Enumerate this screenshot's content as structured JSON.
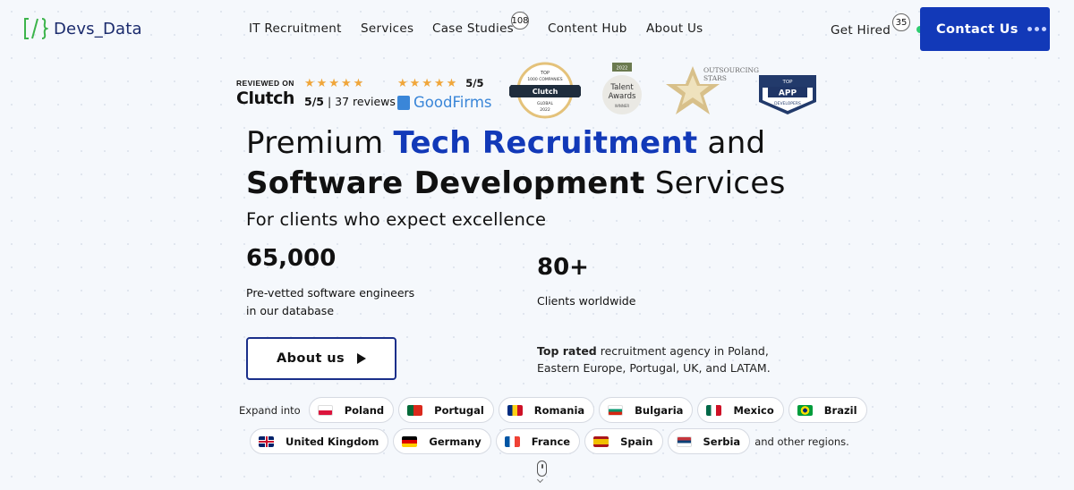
{
  "brand": {
    "name": "Devs_Data",
    "logo_mark": "[/}"
  },
  "nav": {
    "items": [
      {
        "label": "IT Recruitment"
      },
      {
        "label": "Services"
      },
      {
        "label": "Case Studies",
        "badge": "108"
      },
      {
        "label": "Content Hub"
      },
      {
        "label": "About Us"
      }
    ],
    "get_hired": {
      "label": "Get Hired",
      "badge": "35"
    },
    "contact": {
      "label": "Contact Us"
    }
  },
  "reviews": {
    "clutch": {
      "reviewed_on": "REVIEWED ON",
      "logo": "Clutch",
      "stars": "★★★★★",
      "rating_text": "5/5",
      "reviews_text": "| 37 reviews"
    },
    "goodfirms": {
      "stars": "★★★★★",
      "score": "5/5",
      "logo": "GoodFirms"
    },
    "awards": {
      "clutch1000": {
        "top": "TOP",
        "line": "1000 COMPANIES",
        "name": "Clutch",
        "sub": "GLOBAL",
        "year": "2022"
      },
      "talent": {
        "year": "2022",
        "name1": "Talent",
        "name2": "Awards",
        "sub": "WINNER"
      },
      "outsourcing": {
        "line1": "OUTSOURCING",
        "line2": "STARS"
      },
      "app": {
        "top": "TOP",
        "name": "APP",
        "sub": "DEVELOPERS"
      }
    }
  },
  "hero": {
    "line1_a": "Premium ",
    "line1_b": "Tech Recruitment",
    "line1_c": " and",
    "line2_a": "Software Development",
    "line2_b": " Services",
    "subtitle": "For clients who expect excellence",
    "stat1_value": "65,000",
    "stat1_label": "Pre-vetted software engineers in our database",
    "stat2_value": "80+",
    "stat2_label": "Clients worldwide",
    "about_button": "About us",
    "toprated_bold": "Top rated",
    "toprated_rest": " recruitment agency in Poland, Eastern Europe, Portugal, UK, and LATAM."
  },
  "expand": {
    "label": "Expand into",
    "suffix": "and other regions.",
    "row1": [
      "Poland",
      "Portugal",
      "Romania",
      "Bulgaria",
      "Mexico",
      "Brazil"
    ],
    "row2": [
      "United Kingdom",
      "Germany",
      "France",
      "Spain",
      "Serbia"
    ]
  },
  "colors": {
    "primary": "#1239b8",
    "accent_green": "#2ecc71",
    "star": "#f0a63a",
    "goodfirms": "#3a86d8"
  },
  "icons": {
    "scroll": "mouse-scroll-icon",
    "play": "play-icon"
  }
}
